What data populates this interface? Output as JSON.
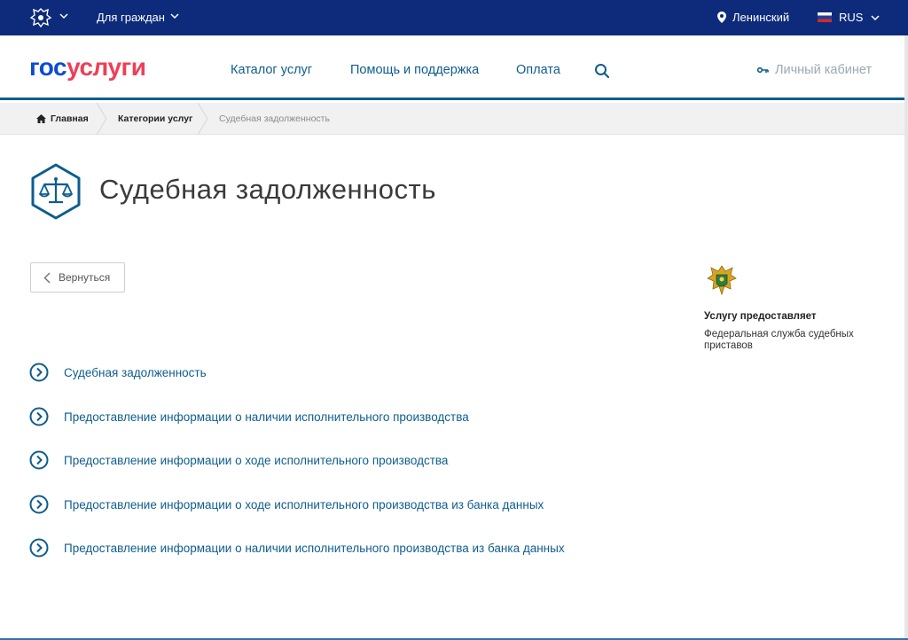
{
  "topbar": {
    "citizens_label": "Для граждан",
    "location": "Ленинский",
    "language": "RUS"
  },
  "header": {
    "logo_part1": "гос",
    "logo_part2": "услуги",
    "nav": [
      "Каталог услуг",
      "Помощь и поддержка",
      "Оплата"
    ],
    "cabinet": "Личный кабинет"
  },
  "breadcrumb": {
    "home": "Главная",
    "category": "Категории услуг",
    "current": "Судебная задолженность"
  },
  "page": {
    "title": "Судебная задолженность",
    "back_label": "Вернуться"
  },
  "provider": {
    "label": "Услугу предоставляет",
    "name": "Федеральная служба судебных приставов"
  },
  "services": [
    "Судебная задолженность",
    "Предоставление информации о наличии исполнительного производства",
    "Предоставление информации о ходе исполнительного производства",
    "Предоставление информации о ходе исполнительного производства из банка данных",
    "Предоставление информации о наличии исполнительного производства из банка данных"
  ],
  "colors": {
    "topbar": "#0d2b7a",
    "accent": "#0e5d8e",
    "logo_blue": "#0d4cd3",
    "logo_red": "#ee3f58"
  }
}
